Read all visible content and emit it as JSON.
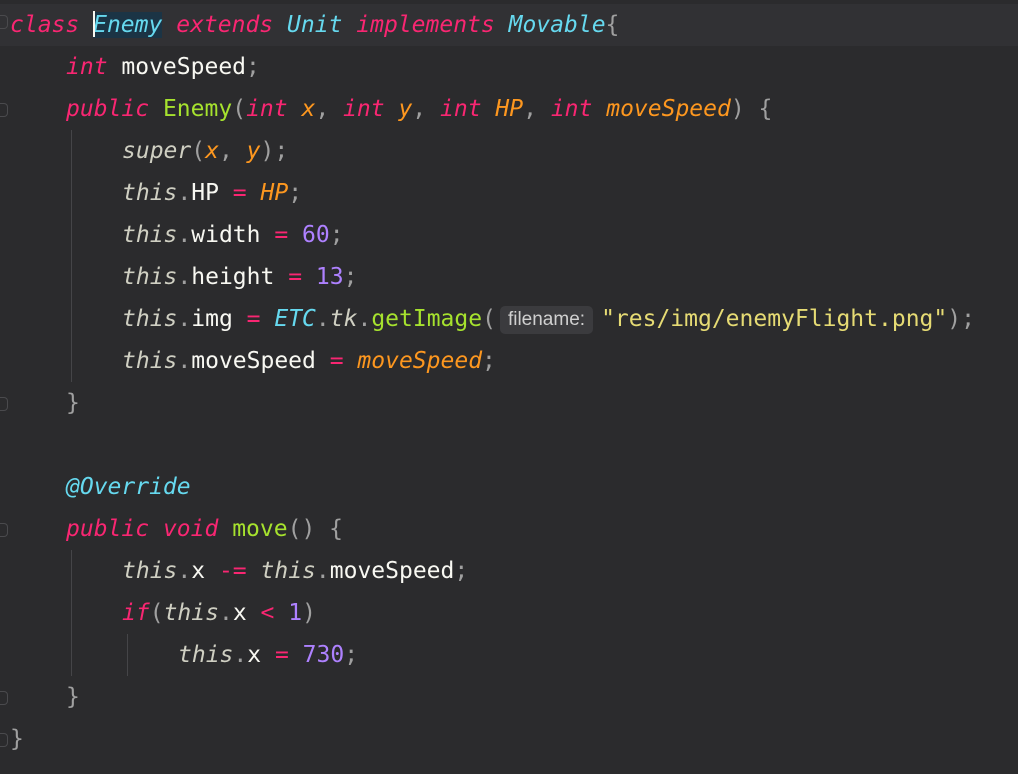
{
  "editor": {
    "colors": {
      "background": "#2b2b2d",
      "keyword": "#f92672",
      "type": "#66d9ef",
      "function": "#a6e22e",
      "parameter": "#fd971f",
      "number": "#ae81ff",
      "string": "#e6db74"
    },
    "lines": [
      {
        "current": true,
        "indent": 0,
        "caret_before_token": 2,
        "tokens": [
          {
            "t": "class",
            "c": "kw"
          },
          {
            "t": " ",
            "c": "id"
          },
          {
            "t": "Enemy",
            "c": "ty sel"
          },
          {
            "t": " ",
            "c": "id"
          },
          {
            "t": "extends",
            "c": "kw"
          },
          {
            "t": " ",
            "c": "id"
          },
          {
            "t": "Unit",
            "c": "ty"
          },
          {
            "t": " ",
            "c": "id"
          },
          {
            "t": "implements",
            "c": "kw"
          },
          {
            "t": " ",
            "c": "id"
          },
          {
            "t": "Movable",
            "c": "ty"
          },
          {
            "t": "{",
            "c": "pu"
          }
        ]
      },
      {
        "indent": 1,
        "tokens": [
          {
            "t": "int",
            "c": "kw"
          },
          {
            "t": " moveSpeed",
            "c": "id"
          },
          {
            "t": ";",
            "c": "pu"
          }
        ]
      },
      {
        "indent": 1,
        "tokens": [
          {
            "t": "public",
            "c": "kw"
          },
          {
            "t": " ",
            "c": "id"
          },
          {
            "t": "Enemy",
            "c": "fn"
          },
          {
            "t": "(",
            "c": "pu"
          },
          {
            "t": "int",
            "c": "kw"
          },
          {
            "t": " ",
            "c": "id"
          },
          {
            "t": "x",
            "c": "pa"
          },
          {
            "t": ", ",
            "c": "pu"
          },
          {
            "t": "int",
            "c": "kw"
          },
          {
            "t": " ",
            "c": "id"
          },
          {
            "t": "y",
            "c": "pa"
          },
          {
            "t": ", ",
            "c": "pu"
          },
          {
            "t": "int",
            "c": "kw"
          },
          {
            "t": " ",
            "c": "id"
          },
          {
            "t": "HP",
            "c": "pa"
          },
          {
            "t": ", ",
            "c": "pu"
          },
          {
            "t": "int",
            "c": "kw"
          },
          {
            "t": " ",
            "c": "id"
          },
          {
            "t": "moveSpeed",
            "c": "pa"
          },
          {
            "t": ") {",
            "c": "pu"
          }
        ]
      },
      {
        "indent": 2,
        "tokens": [
          {
            "t": "super",
            "c": "th"
          },
          {
            "t": "(",
            "c": "pu"
          },
          {
            "t": "x",
            "c": "pa"
          },
          {
            "t": ", ",
            "c": "pu"
          },
          {
            "t": "y",
            "c": "pa"
          },
          {
            "t": ");",
            "c": "pu"
          }
        ]
      },
      {
        "indent": 2,
        "tokens": [
          {
            "t": "this",
            "c": "th"
          },
          {
            "t": ".",
            "c": "pu"
          },
          {
            "t": "HP",
            "c": "id"
          },
          {
            "t": " = ",
            "c": "op"
          },
          {
            "t": "HP",
            "c": "pa"
          },
          {
            "t": ";",
            "c": "pu"
          }
        ]
      },
      {
        "indent": 2,
        "tokens": [
          {
            "t": "this",
            "c": "th"
          },
          {
            "t": ".",
            "c": "pu"
          },
          {
            "t": "width",
            "c": "id"
          },
          {
            "t": " = ",
            "c": "op"
          },
          {
            "t": "60",
            "c": "num"
          },
          {
            "t": ";",
            "c": "pu"
          }
        ]
      },
      {
        "indent": 2,
        "tokens": [
          {
            "t": "this",
            "c": "th"
          },
          {
            "t": ".",
            "c": "pu"
          },
          {
            "t": "height",
            "c": "id"
          },
          {
            "t": " = ",
            "c": "op"
          },
          {
            "t": "13",
            "c": "num"
          },
          {
            "t": ";",
            "c": "pu"
          }
        ]
      },
      {
        "indent": 2,
        "tokens": [
          {
            "t": "this",
            "c": "th"
          },
          {
            "t": ".",
            "c": "pu"
          },
          {
            "t": "img",
            "c": "id"
          },
          {
            "t": " = ",
            "c": "op"
          },
          {
            "t": "ETC",
            "c": "ty"
          },
          {
            "t": ".",
            "c": "pu"
          },
          {
            "t": "tk",
            "c": "th"
          },
          {
            "t": ".",
            "c": "pu"
          },
          {
            "t": "getImage",
            "c": "fn"
          },
          {
            "t": "(",
            "c": "pu"
          },
          {
            "t": "filename:",
            "c": "hint"
          },
          {
            "t": "\"res/img/enemyFlight.png\"",
            "c": "str"
          },
          {
            "t": ");",
            "c": "pu"
          }
        ]
      },
      {
        "indent": 2,
        "tokens": [
          {
            "t": "this",
            "c": "th"
          },
          {
            "t": ".",
            "c": "pu"
          },
          {
            "t": "moveSpeed",
            "c": "id"
          },
          {
            "t": " = ",
            "c": "op"
          },
          {
            "t": "moveSpeed",
            "c": "pa"
          },
          {
            "t": ";",
            "c": "pu"
          }
        ]
      },
      {
        "indent": 1,
        "tokens": [
          {
            "t": "}",
            "c": "pu"
          }
        ]
      },
      {
        "indent": 0,
        "tokens": []
      },
      {
        "indent": 1,
        "tokens": [
          {
            "t": "@Override",
            "c": "an"
          }
        ]
      },
      {
        "indent": 1,
        "tokens": [
          {
            "t": "public",
            "c": "kw"
          },
          {
            "t": " ",
            "c": "id"
          },
          {
            "t": "void",
            "c": "kw"
          },
          {
            "t": " ",
            "c": "id"
          },
          {
            "t": "move",
            "c": "fn"
          },
          {
            "t": "() {",
            "c": "pu"
          }
        ]
      },
      {
        "indent": 2,
        "tokens": [
          {
            "t": "this",
            "c": "th"
          },
          {
            "t": ".",
            "c": "pu"
          },
          {
            "t": "x",
            "c": "id"
          },
          {
            "t": " -= ",
            "c": "op"
          },
          {
            "t": "this",
            "c": "th"
          },
          {
            "t": ".",
            "c": "pu"
          },
          {
            "t": "moveSpeed",
            "c": "id"
          },
          {
            "t": ";",
            "c": "pu"
          }
        ]
      },
      {
        "indent": 2,
        "tokens": [
          {
            "t": "if",
            "c": "kw"
          },
          {
            "t": "(",
            "c": "pu"
          },
          {
            "t": "this",
            "c": "th"
          },
          {
            "t": ".",
            "c": "pu"
          },
          {
            "t": "x",
            "c": "id"
          },
          {
            "t": " < ",
            "c": "op"
          },
          {
            "t": "1",
            "c": "num"
          },
          {
            "t": ")",
            "c": "pu"
          }
        ]
      },
      {
        "indent": 3,
        "tokens": [
          {
            "t": "this",
            "c": "th"
          },
          {
            "t": ".",
            "c": "pu"
          },
          {
            "t": "x",
            "c": "id"
          },
          {
            "t": " = ",
            "c": "op"
          },
          {
            "t": "730",
            "c": "num"
          },
          {
            "t": ";",
            "c": "pu"
          }
        ]
      },
      {
        "indent": 1,
        "tokens": [
          {
            "t": "}",
            "c": "pu"
          }
        ]
      },
      {
        "indent": 0,
        "tokens": [
          {
            "t": "}",
            "c": "pu"
          }
        ]
      }
    ]
  }
}
